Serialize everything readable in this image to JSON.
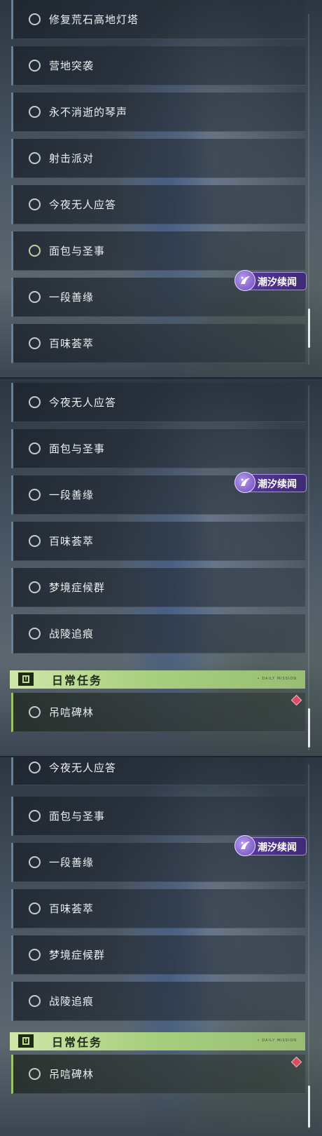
{
  "panel1": {
    "quests": [
      {
        "label": "修复荒石高地灯塔"
      },
      {
        "label": "营地突袭"
      },
      {
        "label": "永不消逝的琴声"
      },
      {
        "label": "射击派对"
      },
      {
        "label": "今夜无人应答"
      },
      {
        "label": "面包与圣事"
      },
      {
        "label": "一段善缘"
      },
      {
        "label": "百味荟萃"
      }
    ],
    "badge": "潮汐续闻"
  },
  "panel2": {
    "quests": [
      {
        "label": "今夜无人应答"
      },
      {
        "label": "面包与圣事"
      },
      {
        "label": "一段善缘"
      },
      {
        "label": "百味荟萃"
      },
      {
        "label": "梦境症候群"
      },
      {
        "label": "战陵追痕"
      }
    ],
    "badge": "潮汐续闻",
    "daily_header": {
      "title": "日常任务",
      "subtitle": "• DAILY MISSION"
    },
    "daily_quests": [
      {
        "label": "吊唁碑林"
      }
    ]
  },
  "panel3": {
    "quests": [
      {
        "label": "今夜无人应答"
      },
      {
        "label": "面包与圣事"
      },
      {
        "label": "一段善缘"
      },
      {
        "label": "百味荟萃"
      },
      {
        "label": "梦境症候群"
      },
      {
        "label": "战陵追痕"
      }
    ],
    "badge": "潮汐续闻",
    "daily_header": {
      "title": "日常任务",
      "subtitle": "• DAILY MISSION"
    },
    "daily_quests": [
      {
        "label": "吊唁碑林"
      }
    ]
  },
  "colors": {
    "badge_purple": "#5a3a9e",
    "daily_green": "#a9cf80",
    "quest_border": "#6b7f93",
    "tracker_diamond": "#d84f62"
  }
}
